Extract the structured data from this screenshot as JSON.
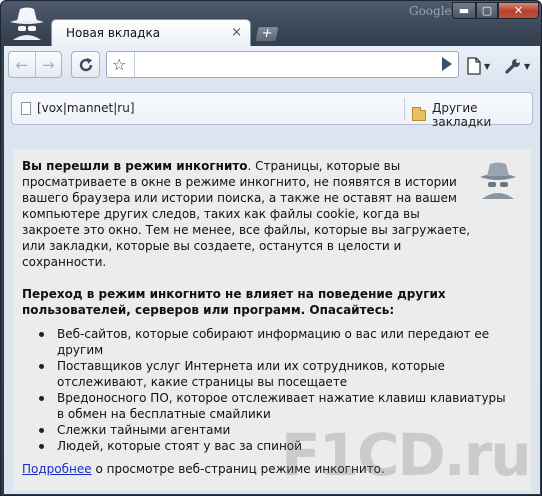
{
  "window": {
    "brand": "Google",
    "min_label": "▬",
    "max_label": "▢",
    "close_label": "✕"
  },
  "tab": {
    "title": "Новая вкладка",
    "close_glyph": "×",
    "new_tab_glyph": "+"
  },
  "toolbar": {
    "back_glyph": "←",
    "forward_glyph": "→",
    "star_glyph": "☆",
    "omnibox_value": ""
  },
  "bookmarks": {
    "item_label": "[vox|mannet|ru]",
    "other_label": "Другие закладки"
  },
  "incognito": {
    "p1_bold": "Вы перешли в режим инкогнито",
    "p1_rest": ". Страницы, которые вы просматриваете в окне в режиме инкогнито, не появятся в истории вашего браузера или истории поиска, а также не оставят на вашем компьютере других следов, таких как файлы cookie, когда вы закроете это окно. Тем не менее, все файлы, которые вы загружаете, или закладки, которые вы создаете, останутся в целости и сохранности.",
    "p2": "Переход в режим инкогнито не влияет на поведение других пользователей, серверов или программ. Опасайтесь:",
    "items": [
      "Веб-сайтов, которые собирают информацию о вас или передают ее другим",
      "Поставщиков услуг Интернета или их сотрудников, которые отслеживают, какие страницы вы посещаете",
      "Вредоносного ПО, которое отслеживает нажатие клавиш клавиатуры в обмен на бесплатные смайлики",
      "Слежки тайными агентами",
      "Людей, которые стоят у вас за спиной"
    ],
    "more_link": "Подробнее",
    "more_rest": " о просмотре веб-страниц режиме инкогнито."
  },
  "watermark": "F1CD.ru"
}
